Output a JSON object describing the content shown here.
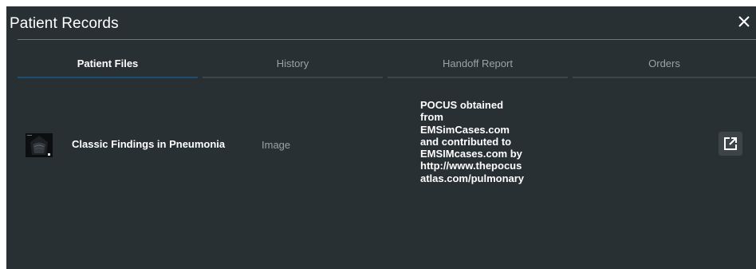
{
  "modal": {
    "title": "Patient Records",
    "close_icon": "close-icon",
    "colors": {
      "background": "#283034",
      "active_tab_underline": "#1f4e73",
      "inactive_tab_underline": "#3e4649",
      "text": "#ffffff",
      "muted_text": "#9ba2a6"
    }
  },
  "tabs": [
    {
      "label": "Patient Files",
      "active": true
    },
    {
      "label": "History",
      "active": false
    },
    {
      "label": "Handoff Report",
      "active": false
    },
    {
      "label": "Orders",
      "active": false
    }
  ],
  "files": [
    {
      "thumbnail_icon": "ultrasound-thumbnail",
      "title": "Classic Findings in Pneumonia",
      "type": "Image",
      "description_lines": [
        "POCUS obtained",
        "from",
        "EMSimCases.com",
        "and contributed to",
        "EMSIMcases.com by",
        "http://www.thepocus",
        "atlas.com/pulmonary"
      ],
      "open_icon": "open-in-new-icon"
    }
  ]
}
